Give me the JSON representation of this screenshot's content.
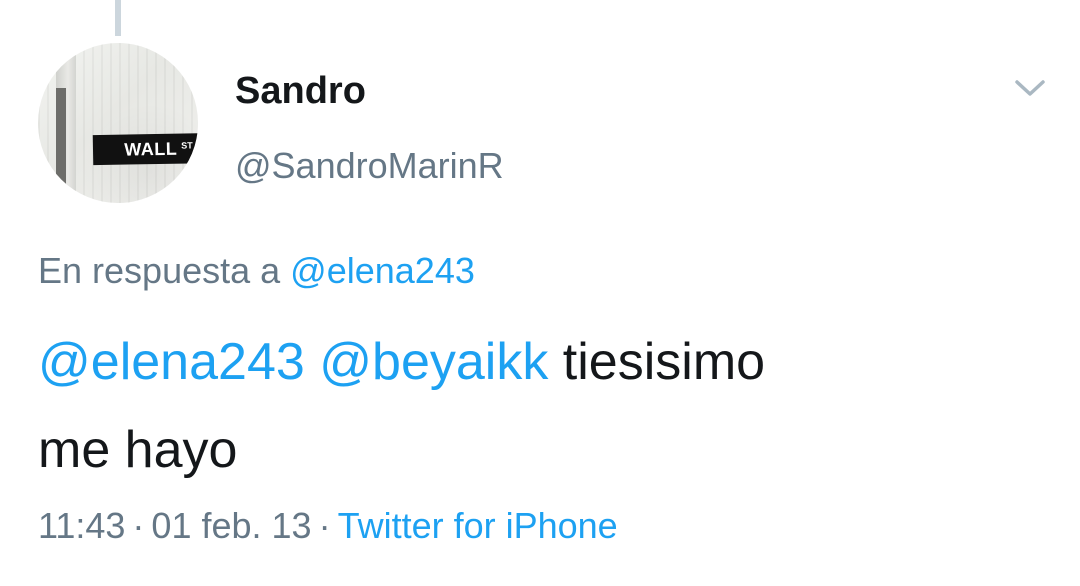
{
  "user": {
    "avatar_sign_text": "WALL",
    "avatar_sign_suffix": "ST",
    "display_name": "Sandro",
    "handle": "@SandroMarinR"
  },
  "reply": {
    "prefix": "En respuesta a",
    "to": "@elena243"
  },
  "tweet": {
    "mention_1": "@elena243",
    "mention_2": "@beyaikk",
    "text_line_1": "tiesisimo",
    "text_line_2": "me hayo"
  },
  "meta": {
    "time": "11:43",
    "date": "01 feb. 13",
    "separator": "·",
    "source": "Twitter for iPhone"
  },
  "icons": {
    "menu": "chevron-down-icon"
  },
  "colors": {
    "link": "#1da1f2",
    "secondary_text": "#657786",
    "primary_text": "#14171a",
    "thread_line": "#ccd6dd"
  }
}
